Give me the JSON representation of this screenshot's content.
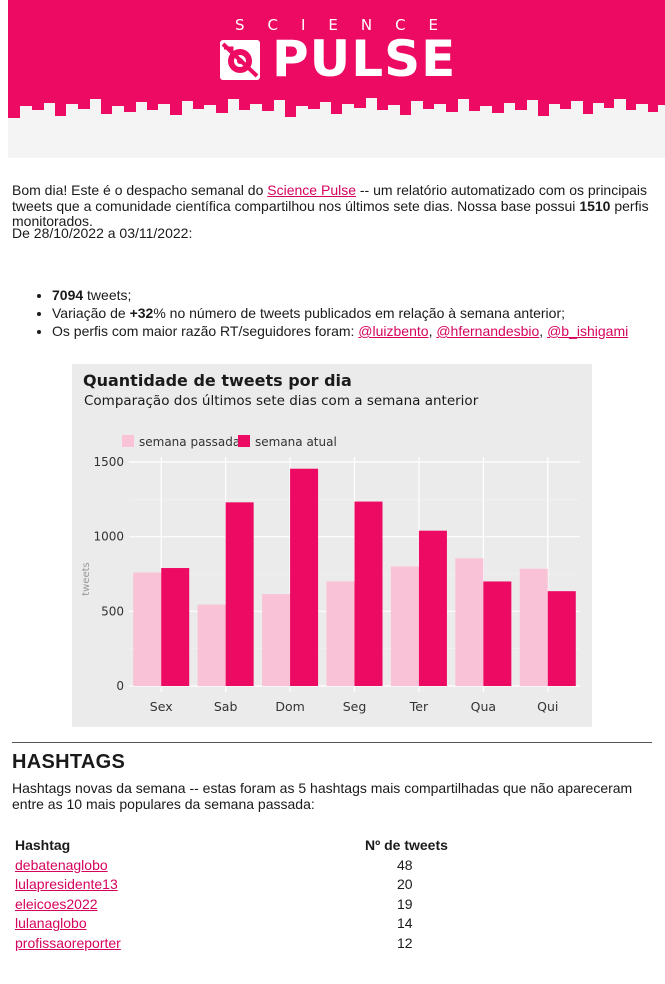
{
  "banner": {
    "brand_top": "SCIENCE",
    "brand_main": "PULSE",
    "color": "#ec0a62"
  },
  "intro": {
    "greeting": "Bom dia! Este é o despacho semanal do ",
    "link_text": "Science Pulse",
    "after_link": " -- um relatório automatizado com os principais tweets que a comunidade científica compartilhou nos últimos sete dias. Nossa base possui ",
    "profiles": "1510",
    "after_profiles": " perfis monitorados."
  },
  "period": "De 28/10/2022 a 03/11/2022:",
  "bullets": {
    "tweets_count": "7094",
    "tweets_suffix": " tweets;",
    "variation_prefix": "Variação de ",
    "variation_value": "+32",
    "variation_suffix": "% no número de tweets publicados em relação à semana anterior;",
    "profiles_prefix": "Os perfis com maior razão RT/seguidores foram: ",
    "profiles": [
      "@luizbento",
      "@hfernandesbio",
      "@b_ishigami"
    ]
  },
  "chart_data": {
    "type": "bar",
    "title": "Quantidade de tweets por dia",
    "subtitle": "Comparação dos últimos sete dias com a semana anterior",
    "xlabel": "",
    "ylabel": "tweets",
    "ylim": [
      0,
      1600
    ],
    "yticks": [
      0,
      500,
      1000,
      1500
    ],
    "categories": [
      "Sex",
      "Sab",
      "Dom",
      "Seg",
      "Ter",
      "Qua",
      "Qui"
    ],
    "series": [
      {
        "name": "semana passada",
        "color": "#fac2d6",
        "values": [
          760,
          545,
          615,
          700,
          800,
          855,
          785
        ]
      },
      {
        "name": "semana atual",
        "color": "#ec0a62",
        "values": [
          790,
          1230,
          1455,
          1235,
          1040,
          700,
          635
        ]
      }
    ],
    "legend": "top-left",
    "grid": true
  },
  "hashtags": {
    "heading": "HASHTAGS",
    "intro": "Hashtags novas da semana -- estas foram as 5 hashtags mais compartilhadas que não apareceram entre as 10 mais populares da semana passada:",
    "col_tag": "Hashtag",
    "col_count": "Nº de tweets",
    "rows": [
      {
        "tag": "debatenaglobo",
        "count": "48"
      },
      {
        "tag": "lulapresidente13",
        "count": "20"
      },
      {
        "tag": "eleicoes2022",
        "count": "19"
      },
      {
        "tag": "lulanaglobo",
        "count": "14"
      },
      {
        "tag": "profissaoreporter",
        "count": "12"
      }
    ]
  }
}
